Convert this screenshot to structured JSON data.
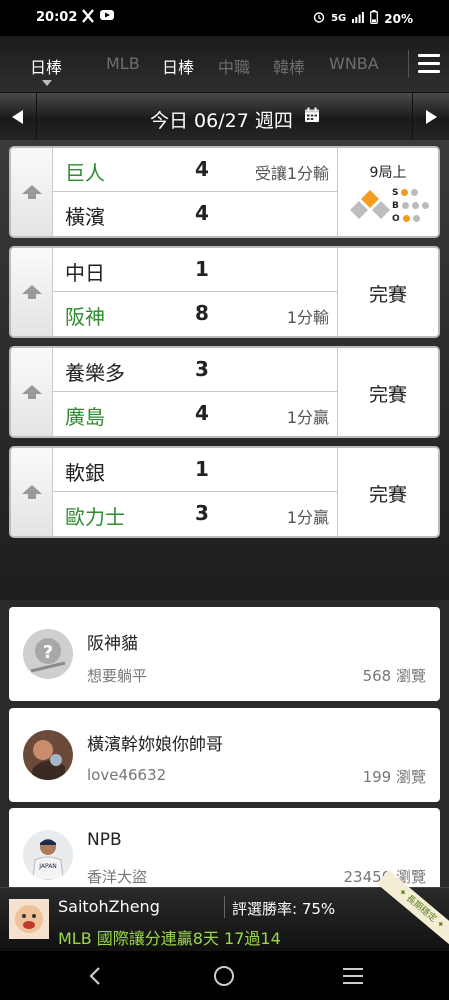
{
  "status_bar": {
    "time": "20:02",
    "network": "5G",
    "battery": "20%"
  },
  "tabs": [
    {
      "label": "日棒",
      "active": true
    },
    {
      "label": "MLB",
      "active": false
    },
    {
      "label": "日棒",
      "active": true
    },
    {
      "label": "中職",
      "active": false
    },
    {
      "label": "韓棒",
      "active": false
    },
    {
      "label": "WNBA",
      "active": false
    }
  ],
  "date_bar": {
    "label": "今日 06/27 週四"
  },
  "games": [
    {
      "home": {
        "name": "巨人",
        "score": "4",
        "note": "受讓1分輸",
        "highlight": true
      },
      "away": {
        "name": "橫濱",
        "score": "4",
        "note": "",
        "highlight": false
      },
      "status": "9局上",
      "live": true,
      "count": {
        "s_label": "S",
        "b_label": "B",
        "o_label": "O",
        "strikes": 1,
        "balls": 0,
        "outs": 1
      }
    },
    {
      "home": {
        "name": "中日",
        "score": "1",
        "note": "",
        "highlight": false
      },
      "away": {
        "name": "阪神",
        "score": "8",
        "note": "1分輸",
        "highlight": true
      },
      "status": "完賽"
    },
    {
      "home": {
        "name": "養樂多",
        "score": "3",
        "note": "",
        "highlight": false
      },
      "away": {
        "name": "廣島",
        "score": "4",
        "note": "1分贏",
        "highlight": true
      },
      "status": "完賽"
    },
    {
      "home": {
        "name": "軟銀",
        "score": "1",
        "note": "",
        "highlight": false
      },
      "away": {
        "name": "歐力士",
        "score": "3",
        "note": "1分贏",
        "highlight": true
      },
      "status": "完賽"
    }
  ],
  "posts": [
    {
      "title": "阪神貓",
      "user": "想要躺平",
      "views": "568 瀏覽",
      "avatar": "question-avatar-icon"
    },
    {
      "title": "橫濱幹妳娘你帥哥",
      "user": "love46632",
      "views": "199 瀏覽",
      "avatar": "user-avatar"
    },
    {
      "title": "NPB",
      "user": "香洋大盜",
      "views": "23450 瀏覽",
      "avatar": "player-avatar"
    }
  ],
  "promo": {
    "name": "SaitohZheng",
    "rate": "評選勝率: 75%",
    "line": "MLB 國際讓分連贏8天 17過14",
    "ribbon": "✦ 長期穩定 ✦"
  },
  "colors": {
    "highlight_green": "#2e8b2e",
    "promo_green": "#9bd84a",
    "base_orange": "#f39c1d"
  }
}
